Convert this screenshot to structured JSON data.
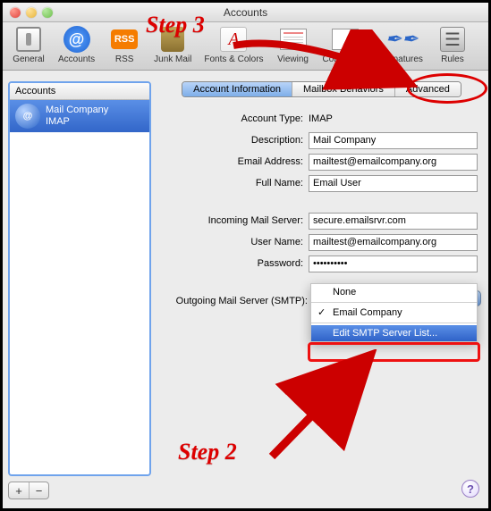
{
  "window": {
    "title": "Accounts"
  },
  "toolbar": {
    "general": "General",
    "accounts": "Accounts",
    "rss": "RSS",
    "rss_badge": "RSS",
    "junk": "Junk Mail",
    "fonts": "Fonts & Colors",
    "viewing": "Viewing",
    "composing": "Composing",
    "signatures": "Signatures",
    "rules": "Rules",
    "at_glyph": "@",
    "fonts_glyph": "A",
    "sign_glyph": "✒✒",
    "rules_glyph": "☰"
  },
  "sidebar": {
    "header": "Accounts",
    "item": {
      "name": "Mail Company",
      "protocol": "IMAP",
      "icon_glyph": "@"
    },
    "add": "+",
    "remove": "−"
  },
  "tabs": {
    "info": "Account Information",
    "mailbox": "Mailbox Behaviors",
    "advanced": "Advanced"
  },
  "form": {
    "account_type_label": "Account Type:",
    "account_type_value": "IMAP",
    "description_label": "Description:",
    "description_value": "Mail Company",
    "email_label": "Email Address:",
    "email_value": "mailtest@emailcompany.org",
    "fullname_label": "Full Name:",
    "fullname_value": "Email User",
    "incoming_label": "Incoming Mail Server:",
    "incoming_value": "secure.emailsrvr.com",
    "username_label": "User Name:",
    "username_value": "mailtest@emailcompany.org",
    "password_label": "Password:",
    "password_value": "••••••••••",
    "smtp_label": "Outgoing Mail Server (SMTP):"
  },
  "smtp_menu": {
    "none": "None",
    "selected": "Email Company",
    "edit": "Edit SMTP Server List..."
  },
  "annotations": {
    "step2": "Step 2",
    "step3": "Step 3"
  },
  "help": "?"
}
